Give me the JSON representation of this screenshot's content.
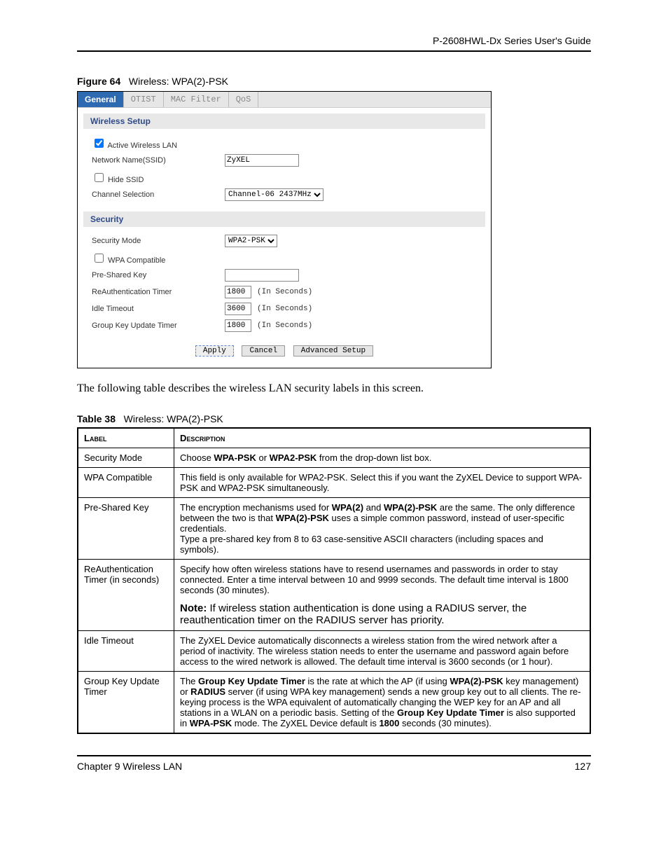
{
  "header": {
    "title": "P-2608HWL-Dx Series User's Guide"
  },
  "figure": {
    "labelPrefix": "Figure 64",
    "title": "Wireless: WPA(2)-PSK"
  },
  "tabs": {
    "general": "General",
    "otist": "OTIST",
    "macfilter": "MAC Filter",
    "qos": "QoS"
  },
  "section": {
    "wsetup": "Wireless Setup",
    "security": "Security"
  },
  "form": {
    "active": "Active Wireless LAN",
    "ssidLabel": "Network Name(SSID)",
    "ssidValue": "ZyXEL",
    "hide": "Hide SSID",
    "channelLabel": "Channel Selection",
    "channelValue": "Channel-06 2437MHz",
    "secmodeLabel": "Security Mode",
    "secmodeValue": "WPA2-PSK",
    "wpaCompat": "WPA Compatible",
    "pskLabel": "Pre-Shared Key",
    "pskValue": "",
    "reauthLabel": "ReAuthentication Timer",
    "reauthValue": "1800",
    "idleLabel": "Idle Timeout",
    "idleValue": "3600",
    "groupLabel": "Group Key Update Timer",
    "groupValue": "1800",
    "unit": "(In Seconds)",
    "apply": "Apply",
    "cancel": "Cancel",
    "adv": "Advanced Setup"
  },
  "bodyText": "The following table describes the wireless LAN security labels in this screen.",
  "tableCaption": {
    "prefix": "Table 38",
    "title": "Wireless: WPA(2)-PSK"
  },
  "tableHead": {
    "label": "Label",
    "desc": "Description"
  },
  "rows": {
    "r1": {
      "label": "Security Mode",
      "p1a": "Choose ",
      "p1b": "WPA-PSK",
      "p1c": " or ",
      "p1d": "WPA2-PSK",
      "p1e": " from the drop-down list box."
    },
    "r2": {
      "label": "WPA Compatible",
      "p1": "This field is only available for WPA2-PSK. Select this if you want the ZyXEL Device to support WPA-PSK and WPA2-PSK simultaneously."
    },
    "r3": {
      "label": "Pre-Shared Key",
      "p1a": "The encryption mechanisms used for ",
      "p1b": "WPA(2)",
      "p1c": " and ",
      "p1d": "WPA(2)-PSK",
      "p1e": " are the same. The only difference between the two is that ",
      "p1f": "WPA(2)-PSK",
      "p1g": " uses a simple common password, instead of user-specific credentials.",
      "p2": "Type a pre-shared key from 8 to 63 case-sensitive ASCII characters (including spaces and symbols)."
    },
    "r4": {
      "label": "ReAuthentication Timer (in seconds)",
      "p1": "Specify how often wireless stations have to resend usernames and passwords in order to stay connected. Enter a time interval between 10 and 9999 seconds. The default time interval is 1800 seconds (30 minutes).",
      "noteLabel": "Note:",
      "noteText": " If wireless station authentication is done using a RADIUS server, the reauthentication timer on the RADIUS server has priority."
    },
    "r5": {
      "label": "Idle Timeout",
      "p1": "The ZyXEL Device automatically disconnects a wireless station from the wired network after a period of inactivity. The wireless station needs to enter the username and password again before access to the wired network is allowed. The default time interval is 3600 seconds (or 1 hour)."
    },
    "r6": {
      "label": "Group Key Update Timer",
      "p1a": "The ",
      "p1b": "Group Key Update Timer",
      "p1c": " is the rate at which the AP (if using ",
      "p1d": "WPA(2)-PSK",
      "p1e": " key management) or ",
      "p1f": "RADIUS",
      "p1g": " server (if using WPA key management) sends a new group key out to all clients. The re-keying process is the WPA equivalent of automatically changing the WEP key for an AP and all stations in a WLAN on a periodic basis. Setting of the ",
      "p1h": "Group Key Update Timer",
      "p1i": " is also supported in ",
      "p1j": "WPA-PSK",
      "p1k": " mode. The ZyXEL Device default is ",
      "p1l": "1800",
      "p1m": " seconds (30 minutes)."
    }
  },
  "footer": {
    "left": "Chapter 9 Wireless LAN",
    "right": "127"
  }
}
